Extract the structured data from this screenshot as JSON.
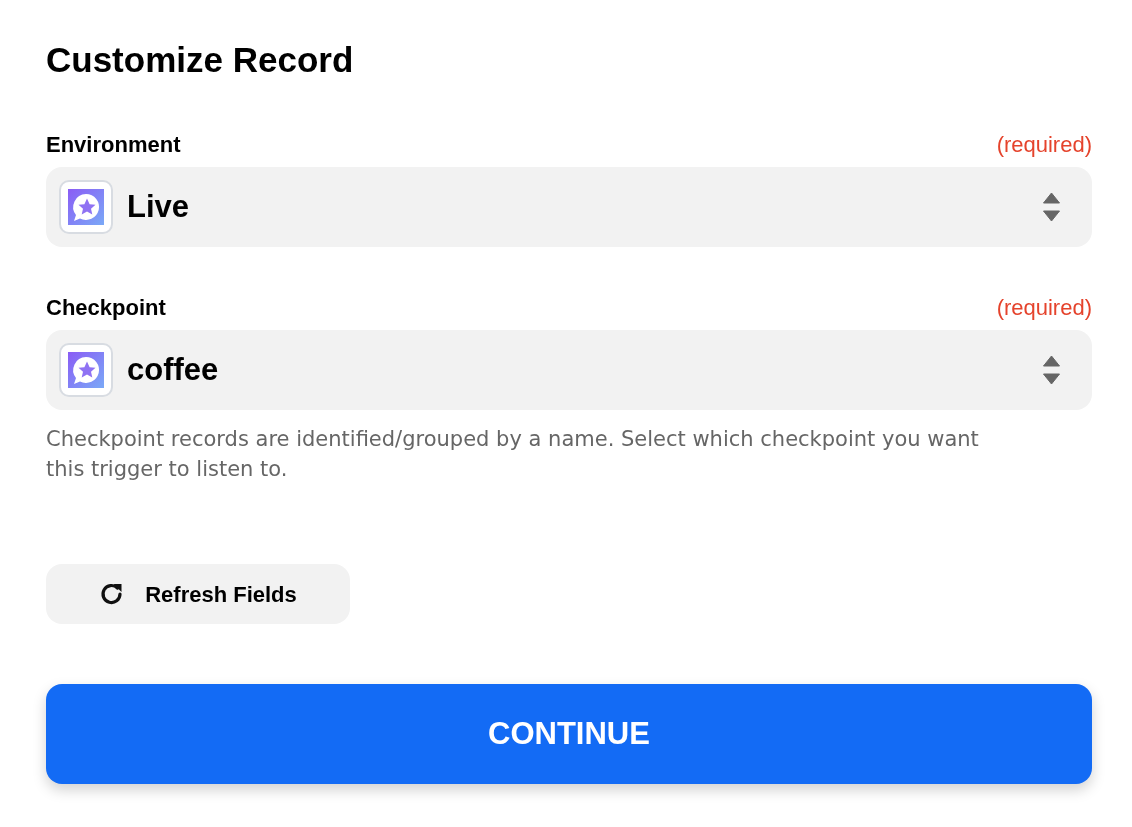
{
  "title": "Customize Record",
  "fields": [
    {
      "label": "Environment",
      "required_note": "(required)",
      "value": "Live"
    },
    {
      "label": "Checkpoint",
      "required_note": "(required)",
      "value": "coffee",
      "help": "Checkpoint records are identified/grouped by a name. Select which checkpoint you want this trigger to listen to."
    }
  ],
  "refresh_button": {
    "label": "Refresh Fields"
  },
  "continue_button": {
    "label": "CONTINUE"
  }
}
